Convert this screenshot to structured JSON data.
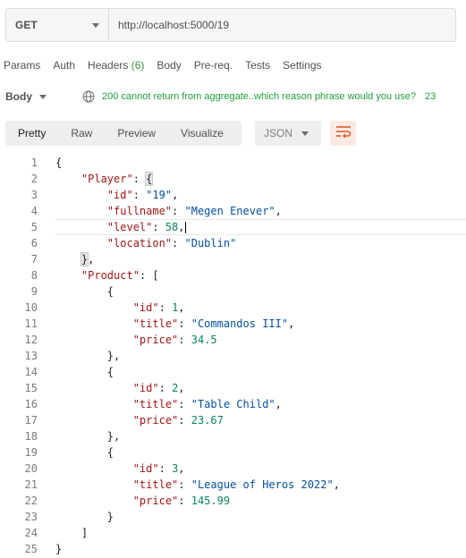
{
  "request": {
    "method": "GET",
    "url": "http://localhost:5000/19"
  },
  "tabs": {
    "params": "Params",
    "auth": "Auth",
    "headers": "Headers",
    "headers_count": "(6)",
    "body": "Body",
    "prereq": "Pre-req.",
    "tests": "Tests",
    "settings": "Settings"
  },
  "response": {
    "body_label": "Body",
    "status_text": "200 cannot return from aggregate..which reason phrase would you use?",
    "status_overflow": "23",
    "view_tabs": [
      "Pretty",
      "Raw",
      "Preview",
      "Visualize"
    ],
    "format": "JSON"
  },
  "editor": {
    "line_numbers": [
      "1",
      "2",
      "3",
      "4",
      "5",
      "6",
      "7",
      "8",
      "9",
      "10",
      "11",
      "12",
      "13",
      "14",
      "15",
      "16",
      "17",
      "18",
      "19",
      "20",
      "21",
      "22",
      "23",
      "24",
      "25"
    ],
    "open_brace": "{",
    "close_brace": "}",
    "player_key": "\"Player\"",
    "id_key": "\"id\"",
    "fullname_key": "\"fullname\"",
    "level_key": "\"level\"",
    "location_key": "\"location\"",
    "product_key": "\"Product\"",
    "title_key": "\"title\"",
    "price_key": "\"price\"",
    "player_id": "\"19\"",
    "player_fullname": "\"Megen Enever\"",
    "player_level": "58",
    "player_location": "\"Dublin\"",
    "products": [
      {
        "id": "1",
        "title": "\"Commandos III\"",
        "price": "34.5"
      },
      {
        "id": "2",
        "title": "\"Table Child\"",
        "price": "23.67"
      },
      {
        "id": "3",
        "title": "\"League of Heros 2022\"",
        "price": "145.99"
      }
    ]
  }
}
